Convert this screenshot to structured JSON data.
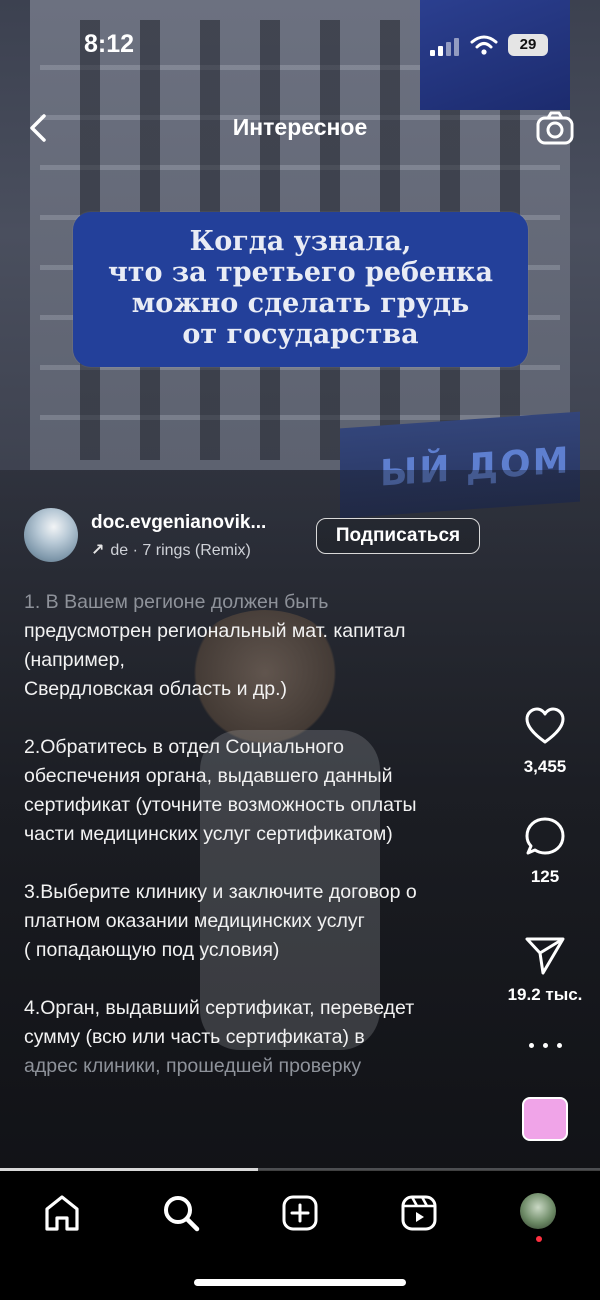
{
  "status_bar": {
    "time": "8:12",
    "battery": "29"
  },
  "header": {
    "title": "Интересное"
  },
  "overlay_caption": "Когда узнала,\nчто за третьего ребенка\nможно сделать грудь\nот государства",
  "background_sign": "ЫЙ ДОМ",
  "author": {
    "username": "doc.evgenianovik...",
    "audio": "de · 7 rings (Remix)",
    "follow_label": "Подписаться"
  },
  "description": [
    {
      "text": "1. В Вашем регионе должен быть",
      "faded": true
    },
    {
      "text": "предусмотрен региональный мат. капитал\n(например,\nСвердловская область и др.)",
      "faded": false
    },
    {
      "text": "2.Обратитесь в отдел Социального\nобеспечения органа, выдавшего данный\nсертификат (уточните возможность оплаты\nчасти медицинских услуг сертификатом)",
      "faded": false
    },
    {
      "text": "3.Выберите клинику и заключите договор о\nплатном оказании медицинских услуг\n( попадающую под условия)",
      "faded": false
    },
    {
      "text": "4.Орган, выдавший сертификат, переведет\nсумму (всю или часть сертификата) в",
      "faded": false
    },
    {
      "text": "адрес клиники, прошедшей проверку",
      "faded": true
    }
  ],
  "actions": {
    "likes": "3,455",
    "comments": "125",
    "shares": "19.2 тыс."
  },
  "progress_fraction": 0.43,
  "tabs": [
    "home-icon",
    "search-icon",
    "create-icon",
    "reels-icon",
    "profile-avatar"
  ],
  "colors": {
    "caption_box": "#23409a",
    "notification_dot": "#ff3040",
    "sound_thumb": "#f0a4e8"
  }
}
